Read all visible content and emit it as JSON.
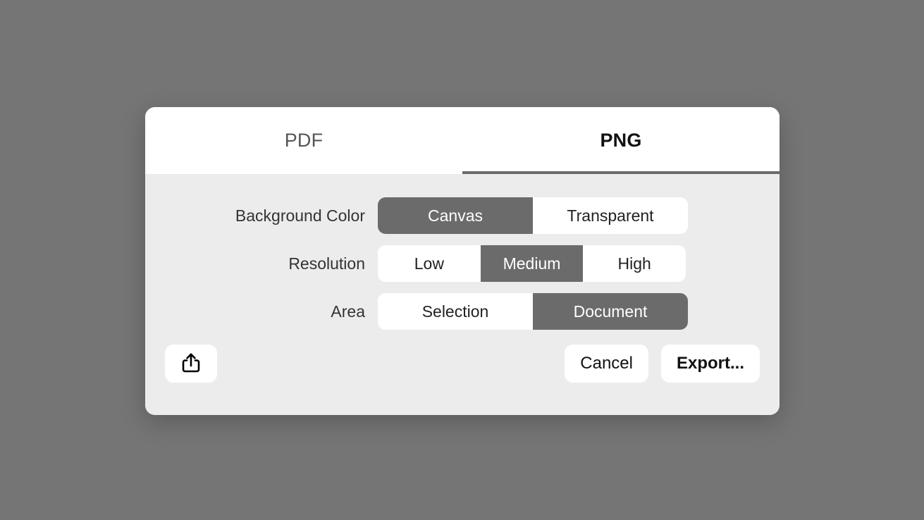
{
  "dialog": {
    "tabs": [
      {
        "label": "PDF",
        "active": false
      },
      {
        "label": "PNG",
        "active": true
      }
    ],
    "rows": [
      {
        "label": "Background Color",
        "options": [
          "Canvas",
          "Transparent"
        ],
        "selected": "Canvas"
      },
      {
        "label": "Resolution",
        "options": [
          "Low",
          "Medium",
          "High"
        ],
        "selected": "Medium"
      },
      {
        "label": "Area",
        "options": [
          "Selection",
          "Document"
        ],
        "selected": "Document"
      }
    ],
    "footer": {
      "share_icon": "share-icon",
      "cancel_label": "Cancel",
      "export_label": "Export..."
    },
    "colors": {
      "backdrop": "#757575",
      "panel": "#ececec",
      "tabbar": "#ffffff",
      "selected_segment": "#6b6b6b",
      "selected_text": "#ffffff",
      "label_text": "#333333",
      "inactive_tab_text": "#555555",
      "active_tab_text": "#111111"
    }
  }
}
